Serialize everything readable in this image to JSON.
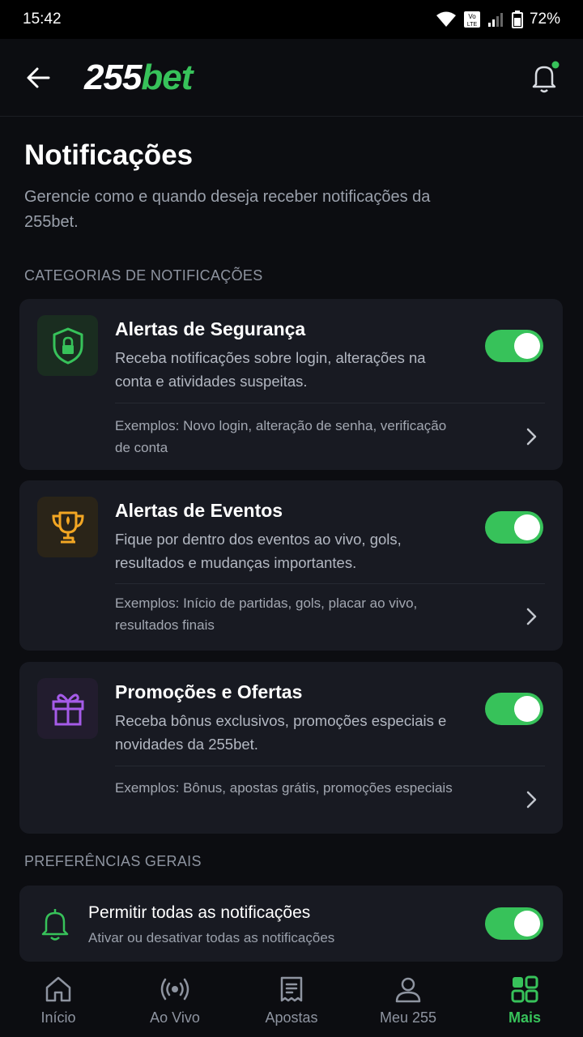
{
  "status_bar": {
    "time": "15:42",
    "battery": "72%"
  },
  "header": {
    "logo_number": "255",
    "logo_word": "bet",
    "brand_color": "#37c25a"
  },
  "page": {
    "title": "Notificações",
    "subtitle": "Gerencie como e quando deseja receber notificações da 255bet."
  },
  "sections": {
    "categories_label": "CATEGORIAS DE NOTIFICAÇÕES",
    "general_label": "PREFERÊNCIAS GERAIS"
  },
  "cards": [
    {
      "icon": "shield-lock-icon",
      "title": "Alertas de Segurança",
      "description": "Receba notificações sobre login, alterações na conta e atividades suspeitas.",
      "examples": "Exemplos: Novo login, alteração de senha, verificação de conta",
      "enabled": true
    },
    {
      "icon": "trophy-icon",
      "title": "Alertas de Eventos",
      "description": "Fique por dentro dos eventos ao vivo, gols, resultados e mudanças importantes.",
      "examples": "Exemplos: Início de partidas, gols, placar ao vivo, resultados finais",
      "enabled": true
    },
    {
      "icon": "gift-icon",
      "title": "Promoções e Ofertas",
      "description": "Receba bônus exclusivos, promoções especiais e novidades da 255bet.",
      "examples": "Exemplos: Bônus, apostas grátis, promoções especiais",
      "enabled": true
    }
  ],
  "preferences": {
    "title": "Permitir todas as notificações",
    "subtitle": "Ativar ou desativar todas as notificações",
    "enabled": true
  },
  "bottom_nav": [
    {
      "label": "Início",
      "icon": "home-icon",
      "active": false
    },
    {
      "label": "Ao Vivo",
      "icon": "live-icon",
      "active": false
    },
    {
      "label": "Apostas",
      "icon": "bets-icon",
      "active": false
    },
    {
      "label": "Meu 255",
      "icon": "user-icon",
      "active": false
    },
    {
      "label": "Mais",
      "icon": "grid-icon",
      "active": true
    }
  ]
}
